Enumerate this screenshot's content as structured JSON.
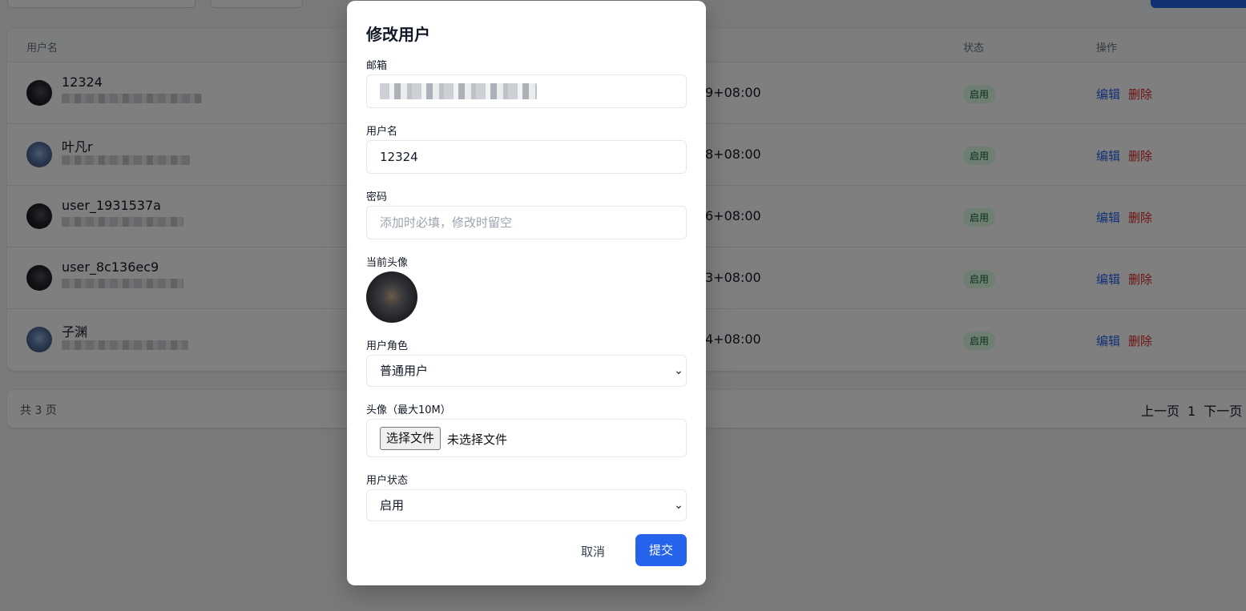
{
  "table": {
    "headers": {
      "username": "用户名",
      "status": "状态",
      "actions": "操作"
    },
    "rows": [
      {
        "username": "12324",
        "time": "9+08:00",
        "status": "启用",
        "edit": "编辑",
        "delete": "删除"
      },
      {
        "username": "叶凡r",
        "time": "8+08:00",
        "status": "启用",
        "edit": "编辑",
        "delete": "删除"
      },
      {
        "username": "user_1931537a",
        "time": "6+08:00",
        "status": "启用",
        "edit": "编辑",
        "delete": "删除"
      },
      {
        "username": "user_8c136ec9",
        "time": "3+08:00",
        "status": "启用",
        "edit": "编辑",
        "delete": "删除"
      },
      {
        "username": "子渊",
        "time": "4+08:00",
        "status": "启用",
        "edit": "编辑",
        "delete": "删除"
      }
    ]
  },
  "pagination": {
    "total": "共 3 页",
    "prev": "上一页",
    "current": "1",
    "next": "下一页"
  },
  "modal": {
    "title": "修改用户",
    "email_label": "邮箱",
    "username_label": "用户名",
    "username_value": "12324",
    "password_label": "密码",
    "password_placeholder": "添加时必填，修改时留空",
    "current_avatar_label": "当前头像",
    "role_label": "用户角色",
    "role_value": "普通用户",
    "avatar_upload_label": "头像（最大10M）",
    "file_button": "选择文件",
    "file_status": "未选择文件",
    "status_label": "用户状态",
    "status_value": "启用",
    "cancel": "取消",
    "submit": "提交"
  },
  "colors": {
    "primary": "#2563eb",
    "danger": "#dc2626",
    "success_bg": "#dcfce7",
    "success_text": "#166534"
  },
  "icons": {
    "select_arrow": "chevron-down-icon"
  }
}
